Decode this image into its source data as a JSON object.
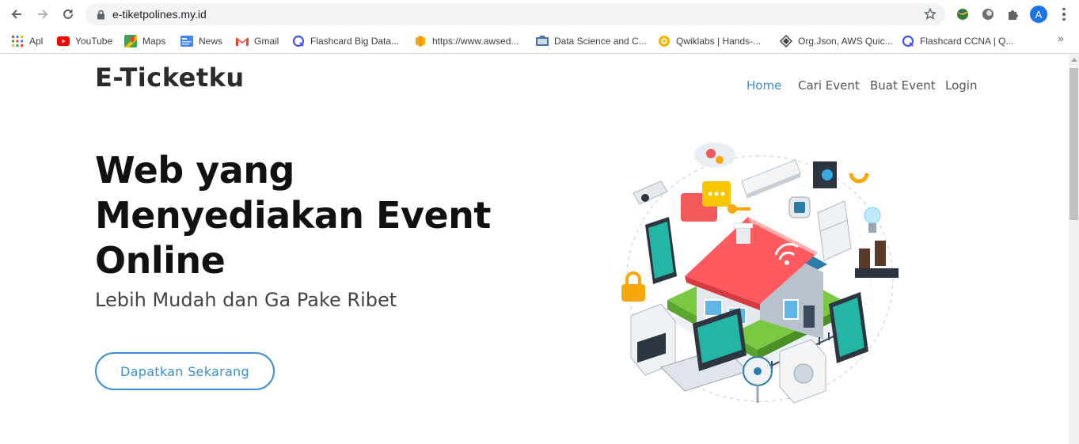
{
  "browser": {
    "url": "e-tiketpolines.my.id",
    "profile_initial": "A",
    "bookmarks": [
      {
        "label": "Apl",
        "icon": "apps-grid-icon"
      },
      {
        "label": "YouTube",
        "icon": "youtube-icon"
      },
      {
        "label": "Maps",
        "icon": "maps-icon"
      },
      {
        "label": "News",
        "icon": "news-icon"
      },
      {
        "label": "Gmail",
        "icon": "gmail-icon"
      },
      {
        "label": "Flashcard Big Data...",
        "icon": "quizlet-icon"
      },
      {
        "label": "https://www.awsed...",
        "icon": "aws-icon"
      },
      {
        "label": "Data Science and C...",
        "icon": "site-icon"
      },
      {
        "label": "Qwiklabs | Hands-...",
        "icon": "qwiklabs-icon"
      },
      {
        "label": "Org.Json, AWS Quic...",
        "icon": "diamond-icon"
      },
      {
        "label": "Flashcard CCNA | Q...",
        "icon": "quizlet-icon"
      }
    ],
    "more_bookmarks": "»"
  },
  "site": {
    "brand": "E-Ticketku",
    "nav": [
      {
        "label": "Home",
        "active": true
      },
      {
        "label": "Cari Event",
        "active": false
      },
      {
        "label": "Buat Event",
        "active": false
      },
      {
        "label": "Login",
        "active": false
      }
    ],
    "hero": {
      "title": "Web yang Menyediakan Event Online",
      "subtitle": "Lebih Mudah dan Ga Pake Ribet",
      "cta": "Dapatkan Sekarang"
    }
  },
  "colors": {
    "accent": "#3a8fd4",
    "heading": "#111111",
    "omnibox_bg": "#f1f3f4"
  }
}
